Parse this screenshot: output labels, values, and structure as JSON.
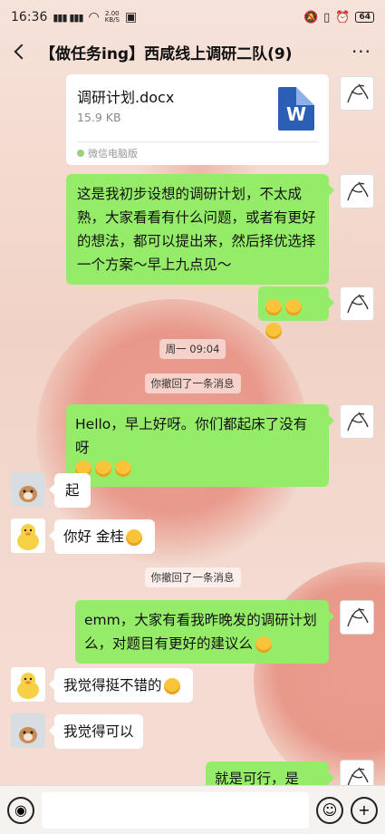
{
  "status": {
    "time": "16:36",
    "speed": "2.00\nKB/S",
    "battery": "64"
  },
  "header": {
    "title": "【做任务ing】西咸线上调研二队(9)"
  },
  "file_message": {
    "name": "调研计划.docx",
    "size": "15.9 KB",
    "source": "微信电脑版",
    "icon_letter": "W"
  },
  "messages": {
    "m1": "这是我初步设想的调研计划，不太成熟，大家看看有什么问题，或者有更好的想法，都可以提出来，然后择优选择一个方案～早上九点见～",
    "t1": "周一 09:04",
    "r1": "你撤回了一条消息",
    "m2": "Hello，早上好呀。你们都起床了没有呀",
    "m3": "起",
    "m4": "你好 金桂",
    "r2": "你撤回了一条消息",
    "m5": "emm，大家有看我昨晚发的调研计划么，对题目有更好的建议么",
    "m6": "我觉得挺不错的",
    "m7": "我觉得可以",
    "m8": "就是可行，是吧?"
  },
  "colors": {
    "green_bubble": "#95ec69",
    "white_bubble": "#ffffff"
  }
}
